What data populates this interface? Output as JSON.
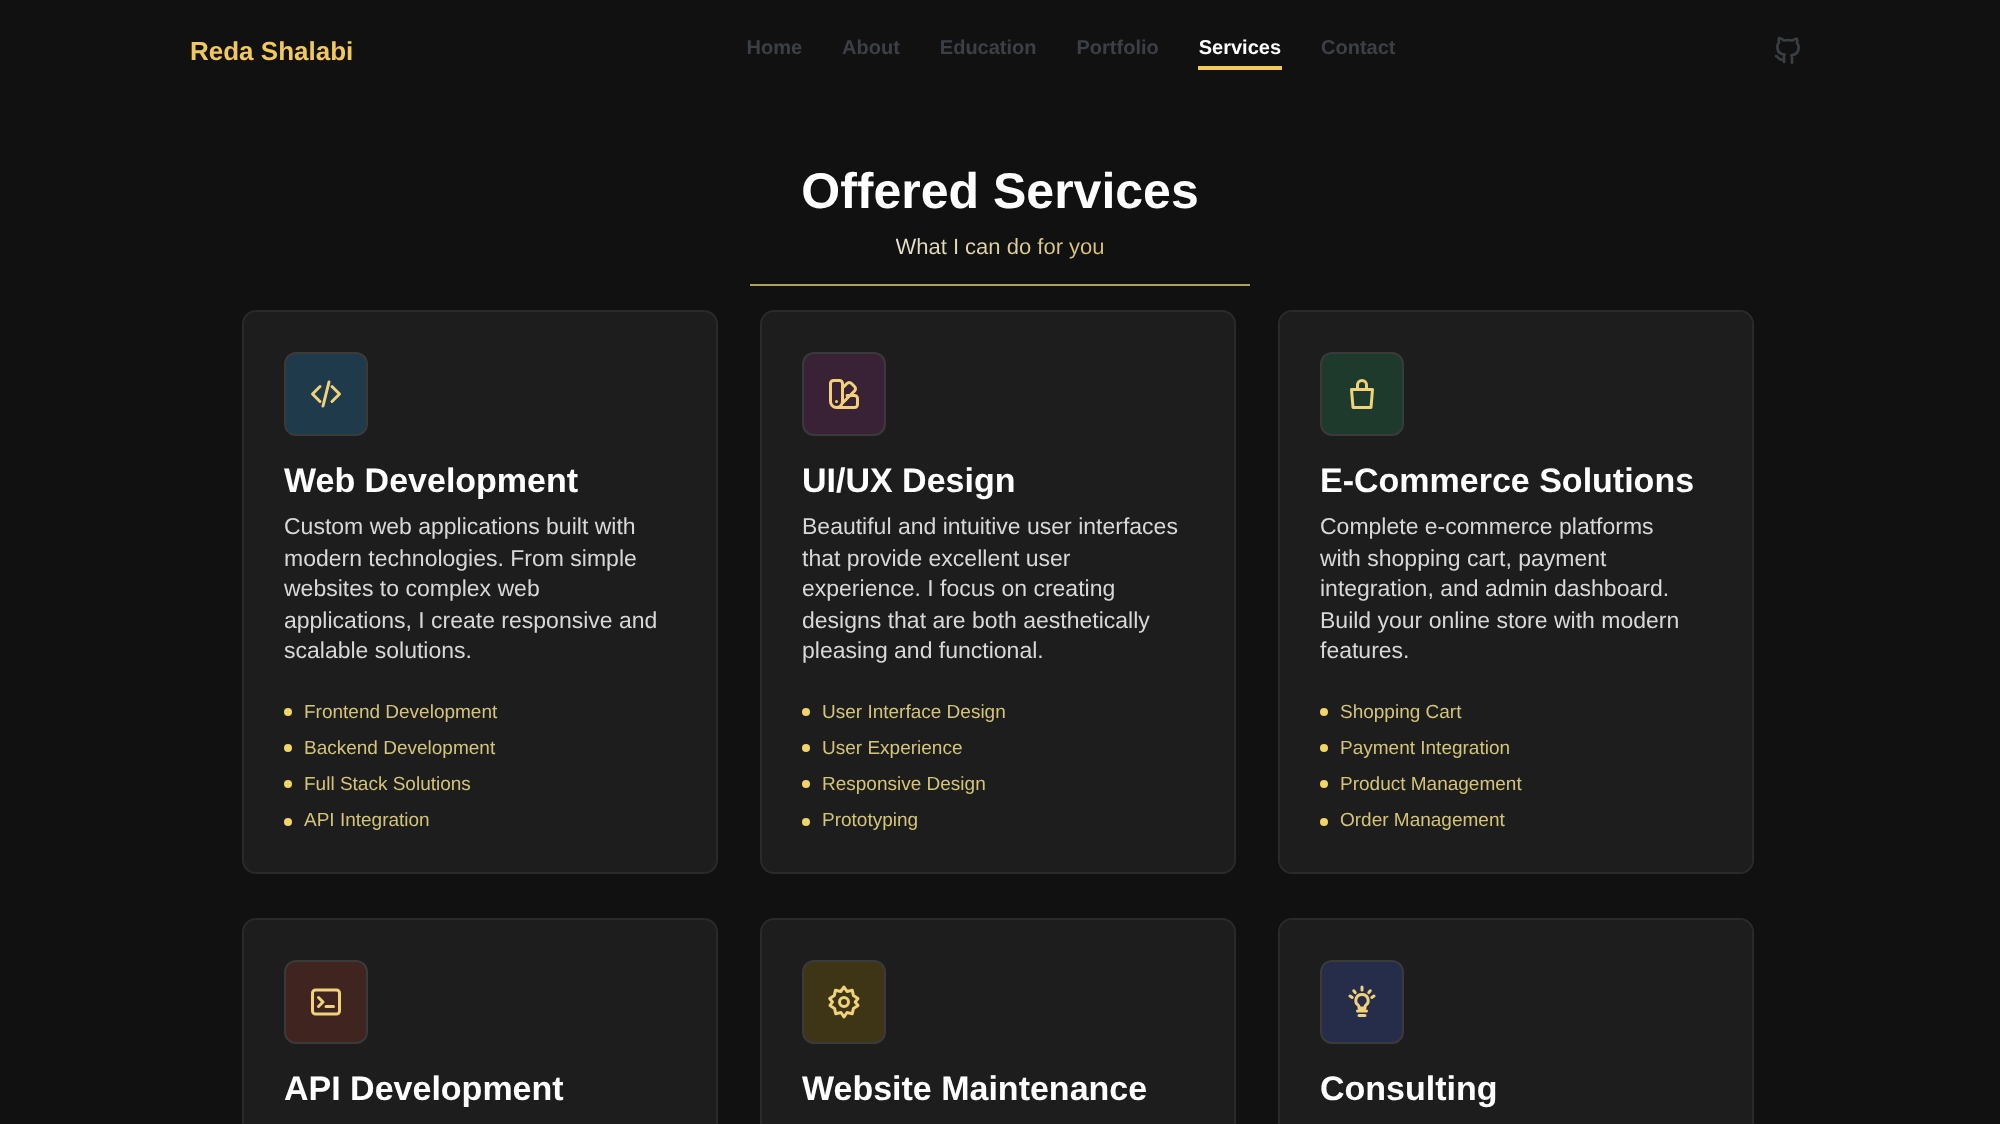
{
  "header": {
    "logo": "Reda Shalabi",
    "nav": [
      {
        "label": "Home",
        "selected": false
      },
      {
        "label": "About",
        "selected": false
      },
      {
        "label": "Education",
        "selected": false
      },
      {
        "label": "Portfolio",
        "selected": false
      },
      {
        "label": "Services",
        "selected": true
      },
      {
        "label": "Contact",
        "selected": false
      }
    ]
  },
  "section": {
    "title": "Offered Services",
    "subtitle": "What I can do for you"
  },
  "services": [
    {
      "title": "Web Development",
      "color": "#1f3a4a",
      "description": "Custom web applications built with modern technologies. From simple websites to complex web applications, I create responsive and scalable solutions.",
      "features": [
        "Frontend Development",
        "Backend Development",
        "Full Stack Solutions",
        "API Integration"
      ]
    },
    {
      "title": "UI/UX Design",
      "color": "#3a2236",
      "description": "Beautiful and intuitive user interfaces that provide excellent user experience. I focus on creating designs that are both aesthetically pleasing and functional.",
      "features": [
        "User Interface Design",
        "User Experience",
        "Responsive Design",
        "Prototyping"
      ]
    },
    {
      "title": "E-Commerce Solutions",
      "color": "#1e3a2c",
      "description": "Complete e-commerce platforms with shopping cart, payment integration, and admin dashboard. Build your online store with modern features.",
      "features": [
        "Shopping Cart",
        "Payment Integration",
        "Product Management",
        "Order Management"
      ]
    },
    {
      "title": "API Development",
      "color": "#3f2420"
    },
    {
      "title": "Website Maintenance",
      "color": "#3d3516"
    },
    {
      "title": "Consulting",
      "color": "#262d4a"
    }
  ]
}
